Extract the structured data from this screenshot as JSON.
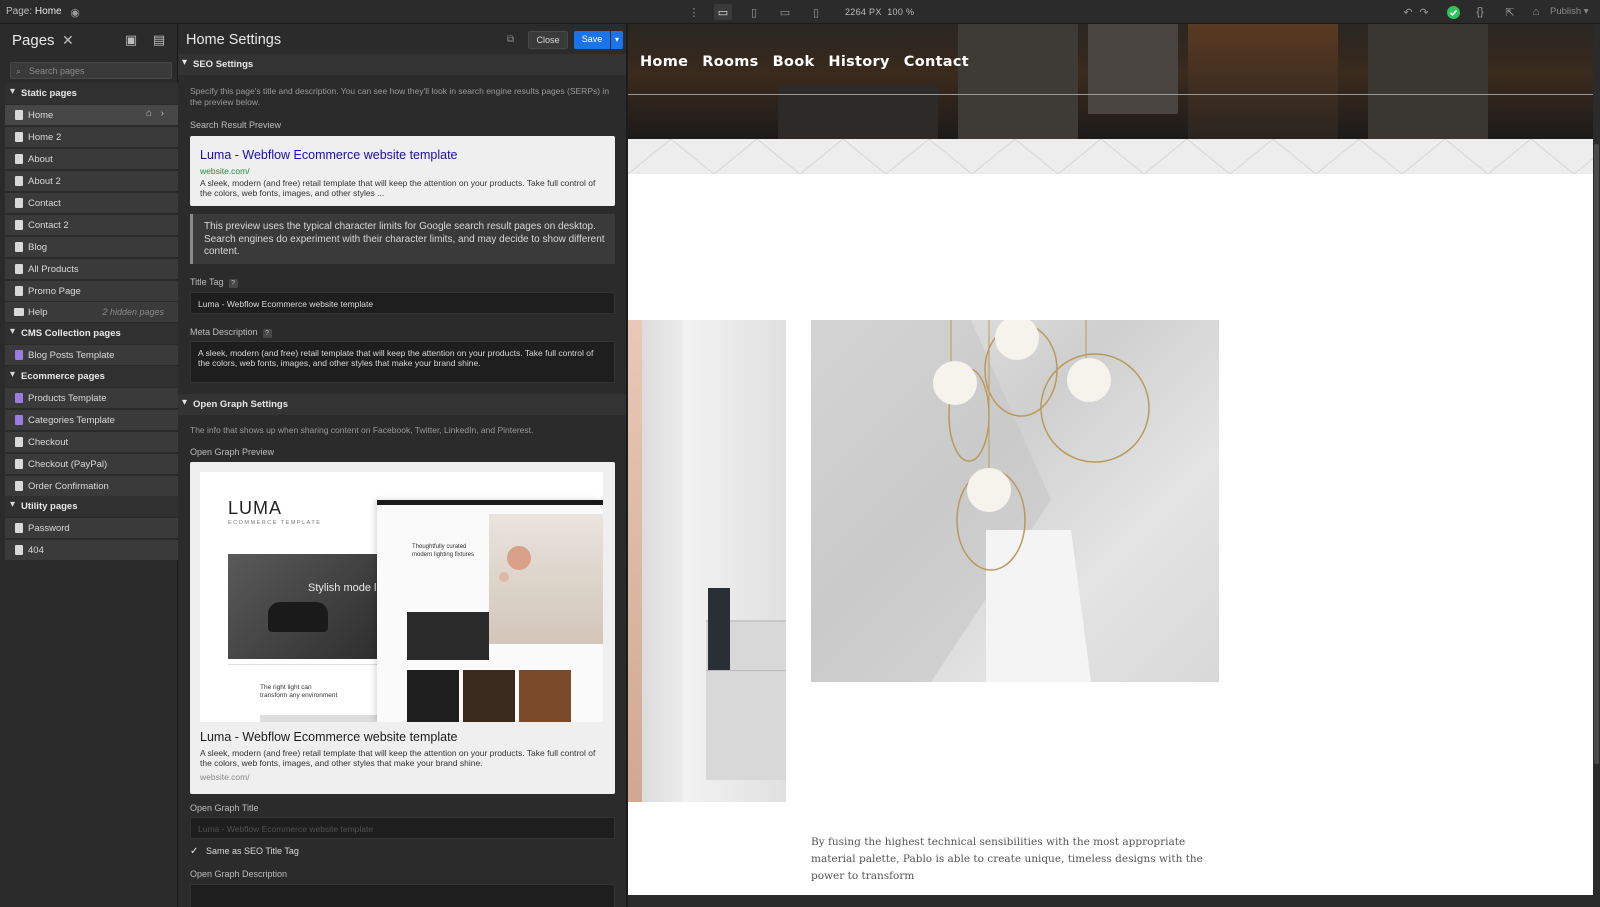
{
  "topbar": {
    "page_label": "Page:",
    "page_name": "Home",
    "zoom_width": "2264 PX",
    "zoom_pct": "100 %",
    "publish_label": "Publish"
  },
  "pages_panel": {
    "title": "Pages",
    "search_placeholder": "Search pages",
    "sections": {
      "static": "Static pages",
      "cms": "CMS Collection pages",
      "ecommerce": "Ecommerce pages",
      "utility": "Utility pages"
    },
    "static_pages": [
      "Home",
      "Home 2",
      "About",
      "About 2",
      "Contact",
      "Contact 2",
      "Blog",
      "All Products",
      "Promo Page"
    ],
    "help_folder": "Help",
    "help_hidden": "2 hidden pages",
    "cms_pages": [
      "Blog Posts Template"
    ],
    "ecommerce_pages": [
      "Products Template",
      "Categories Template",
      "Checkout",
      "Checkout (PayPal)",
      "Order Confirmation"
    ],
    "utility_pages": [
      "Password",
      "404"
    ]
  },
  "settings": {
    "title": "Home Settings",
    "close_label": "Close",
    "save_label": "Save",
    "seo_section": "SEO Settings",
    "seo_help": "Specify this page's title and description. You can see how they'll look in search engine results pages (SERPs) in the preview below.",
    "search_preview_label": "Search Result Preview",
    "serp_title": "Luma - Webflow Ecommerce website template",
    "serp_url": "website.com/",
    "serp_desc": "A sleek, modern (and free) retail template that will keep the attention on your products. Take full control of the colors, web fonts, images, and other styles ...",
    "note": "This preview uses the typical character limits for Google search result pages on desktop. Search engines do experiment with their character limits, and may decide to show different content.",
    "title_tag_label": "Title Tag",
    "title_tag_value": "Luma - Webflow Ecommerce website template",
    "meta_desc_label": "Meta Description",
    "meta_desc_value": "A sleek, modern (and free) retail template that will keep the attention on your products. Take full control of the colors, web fonts, images, and other styles that make your brand shine.",
    "og_section": "Open Graph Settings",
    "og_help": "The info that shows up when sharing content on Facebook, Twitter, LinkedIn, and Pinterest.",
    "og_preview_label": "Open Graph Preview",
    "og_image": {
      "brand": "LUMA",
      "brand_sub": "ECOMMERCE TEMPLATE",
      "hero_text": "Stylish mode lighting optio",
      "right_heading": "Thoughtfully curated modern lighting fixtures",
      "bottom_text": "The right light can transform any environment"
    },
    "og_title": "Luma - Webflow Ecommerce website template",
    "og_desc": "A sleek, modern (and free) retail template that will keep the attention on your products. Take full control of the colors, web fonts, images, and other styles that make your brand shine.",
    "og_url": "website.com/",
    "og_title_label": "Open Graph Title",
    "og_title_placeholder": "Luma - Webflow Ecommerce website template",
    "same_as_seo": "Same as SEO Title Tag",
    "og_desc_label": "Open Graph Description"
  },
  "canvas": {
    "nav": [
      "Home",
      "Rooms",
      "Book",
      "History",
      "Contact"
    ],
    "paragraph": "By fusing the highest technical sensibilities with the most appropriate material palette, Pablo is able to create unique, timeless designs with the power to transform"
  },
  "colors": {
    "accent": "#1a73e8",
    "status_ok": "#2ec45a",
    "serp_title": "#1a0dab",
    "serp_url": "#1e8e3e"
  }
}
